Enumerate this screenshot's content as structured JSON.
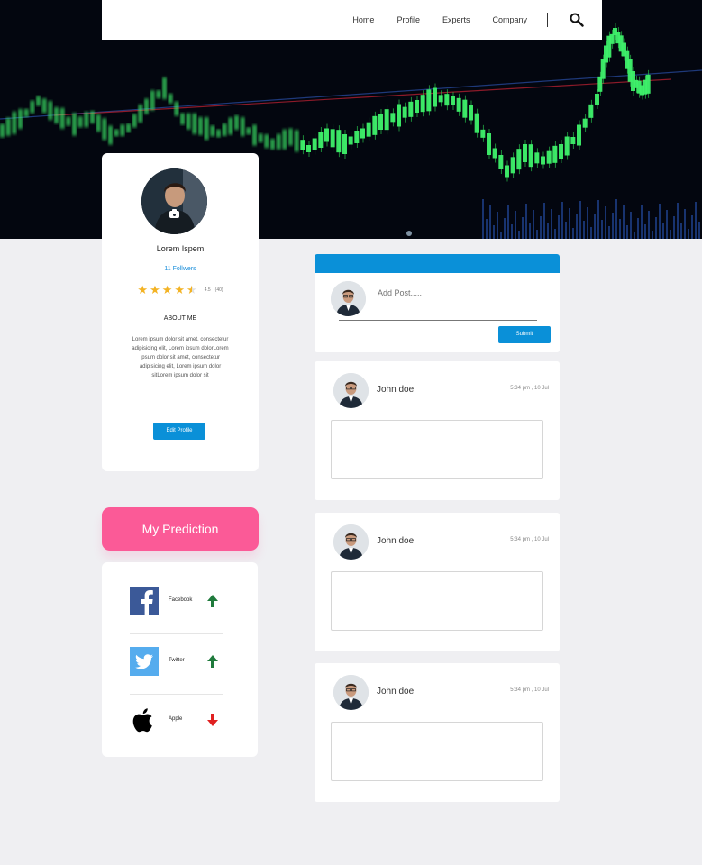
{
  "nav": {
    "items": [
      "Home",
      "Profile",
      "Experts",
      "Company"
    ],
    "search_icon": "search-icon"
  },
  "profile": {
    "name": "Lorem Ispem",
    "followers": "11 Follwers",
    "rating_value": "4.5",
    "rating_count": "(40)",
    "rating_stars": 4.5,
    "about_title": "ABOUT ME",
    "about_text": "Lorem ipsum dolor sit amet, consectetur adipisicing elit, Lorem ipsum dolorLorem ipsum dolor sit amet, consectetur adipisicing elit, Lorem ipsum dolor sitLorem ipsum dolor sit",
    "edit_label": "Edit Profile",
    "camera_icon": "camera-icon"
  },
  "prediction": {
    "title": "My Prediction",
    "items": [
      {
        "label": "Facebook",
        "icon": "facebook-icon",
        "trend": "up",
        "color": "#3b5998"
      },
      {
        "label": "Twitter",
        "icon": "twitter-icon",
        "trend": "up",
        "color": "#55acee"
      },
      {
        "label": "Apple",
        "icon": "apple-icon",
        "trend": "down",
        "color": "#000000"
      }
    ]
  },
  "composer": {
    "placeholder": "Add Post.....",
    "submit_label": "Submit"
  },
  "posts": [
    {
      "author": "John doe",
      "time": "5:34 pm , 10 Jul"
    },
    {
      "author": "John doe",
      "time": "5:34 pm , 10 Jul"
    },
    {
      "author": "John doe",
      "time": "5:34 pm , 10 Jul"
    }
  ],
  "colors": {
    "accent": "#0a90d8",
    "prediction": "#fb5a97",
    "up": "#1f7a3c",
    "down": "#e02020",
    "star": "#f3b324"
  }
}
